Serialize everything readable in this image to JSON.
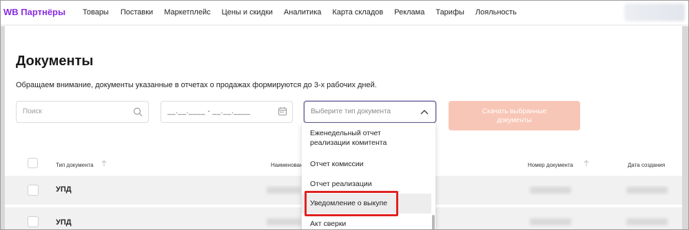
{
  "brand": {
    "logo": "WB Партнёры",
    "color": "#8a2be2"
  },
  "nav": [
    "Товары",
    "Поставки",
    "Маркетплейс",
    "Цены и скидки",
    "Аналитика",
    "Карта складов",
    "Реклама",
    "Тарифы",
    "Лояльность"
  ],
  "page": {
    "title": "Документы",
    "notice": "Обращаем внимание, документы указанные в отчетах о продажах формируются до 3-х рабочих дней."
  },
  "filters": {
    "search_placeholder": "Поиск",
    "date_range": "__.__.____ - __.__.____",
    "doc_type_placeholder": "Выберите тип документа",
    "download_label": "Скачать выбранные документы",
    "download_color": "#f8c6b6"
  },
  "table": {
    "headers": {
      "type": "Тип документа",
      "name": "Наименован",
      "number": "Номер документа",
      "date": "Дата создания"
    },
    "rows": [
      {
        "type": "УПД"
      },
      {
        "type": "УПД"
      }
    ]
  },
  "dropdown": {
    "items": [
      {
        "label": "Еженедельный отчет реализации комитента"
      },
      {
        "label": "Отчет комиссии"
      },
      {
        "label": "Отчет реализации"
      },
      {
        "label": "Уведомление о выкупе",
        "highlighted": true
      },
      {
        "label": "Акт сверки"
      }
    ],
    "highlight_color": "#e02020"
  }
}
